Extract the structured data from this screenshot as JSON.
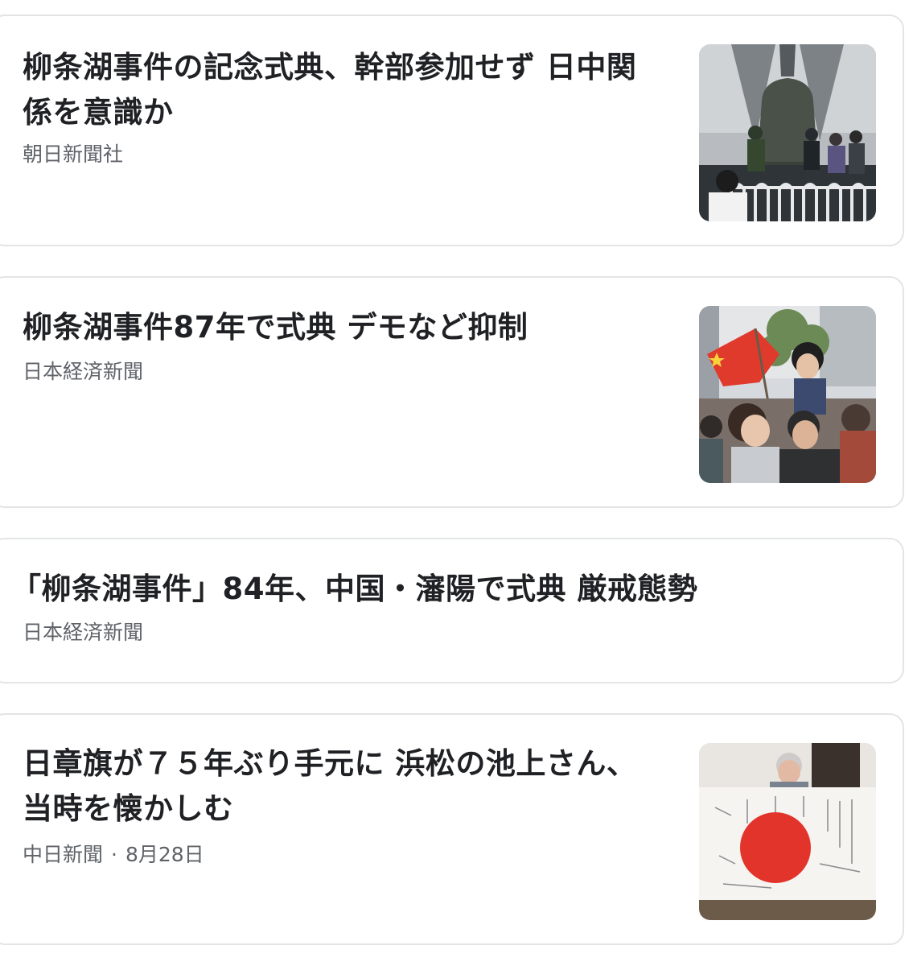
{
  "articles": [
    {
      "title": "柳条湖事件の記念式典、幹部参加せず 日中関係を意識か",
      "source": "朝日新聞社",
      "thumbnail_icon": "bell-ceremony-photo"
    },
    {
      "title": "柳条湖事件87年で式典 デモなど抑制",
      "source": "日本経済新聞",
      "thumbnail_icon": "crowd-flag-photo"
    },
    {
      "title": "「柳条湖事件」84年、中国・瀋陽で式典 厳戒態勢",
      "source": "日本経済新聞"
    },
    {
      "title": "日章旗が７５年ぶり手元に 浜松の池上さん、当時を懐かしむ",
      "source": "中日新聞",
      "date": "8月28日",
      "thumbnail_icon": "rising-sun-flag-photo"
    }
  ],
  "colors": {
    "title": "#202124",
    "meta": "#5f6368",
    "border": "#e3e4e6",
    "flag_red": "#e3342b"
  }
}
